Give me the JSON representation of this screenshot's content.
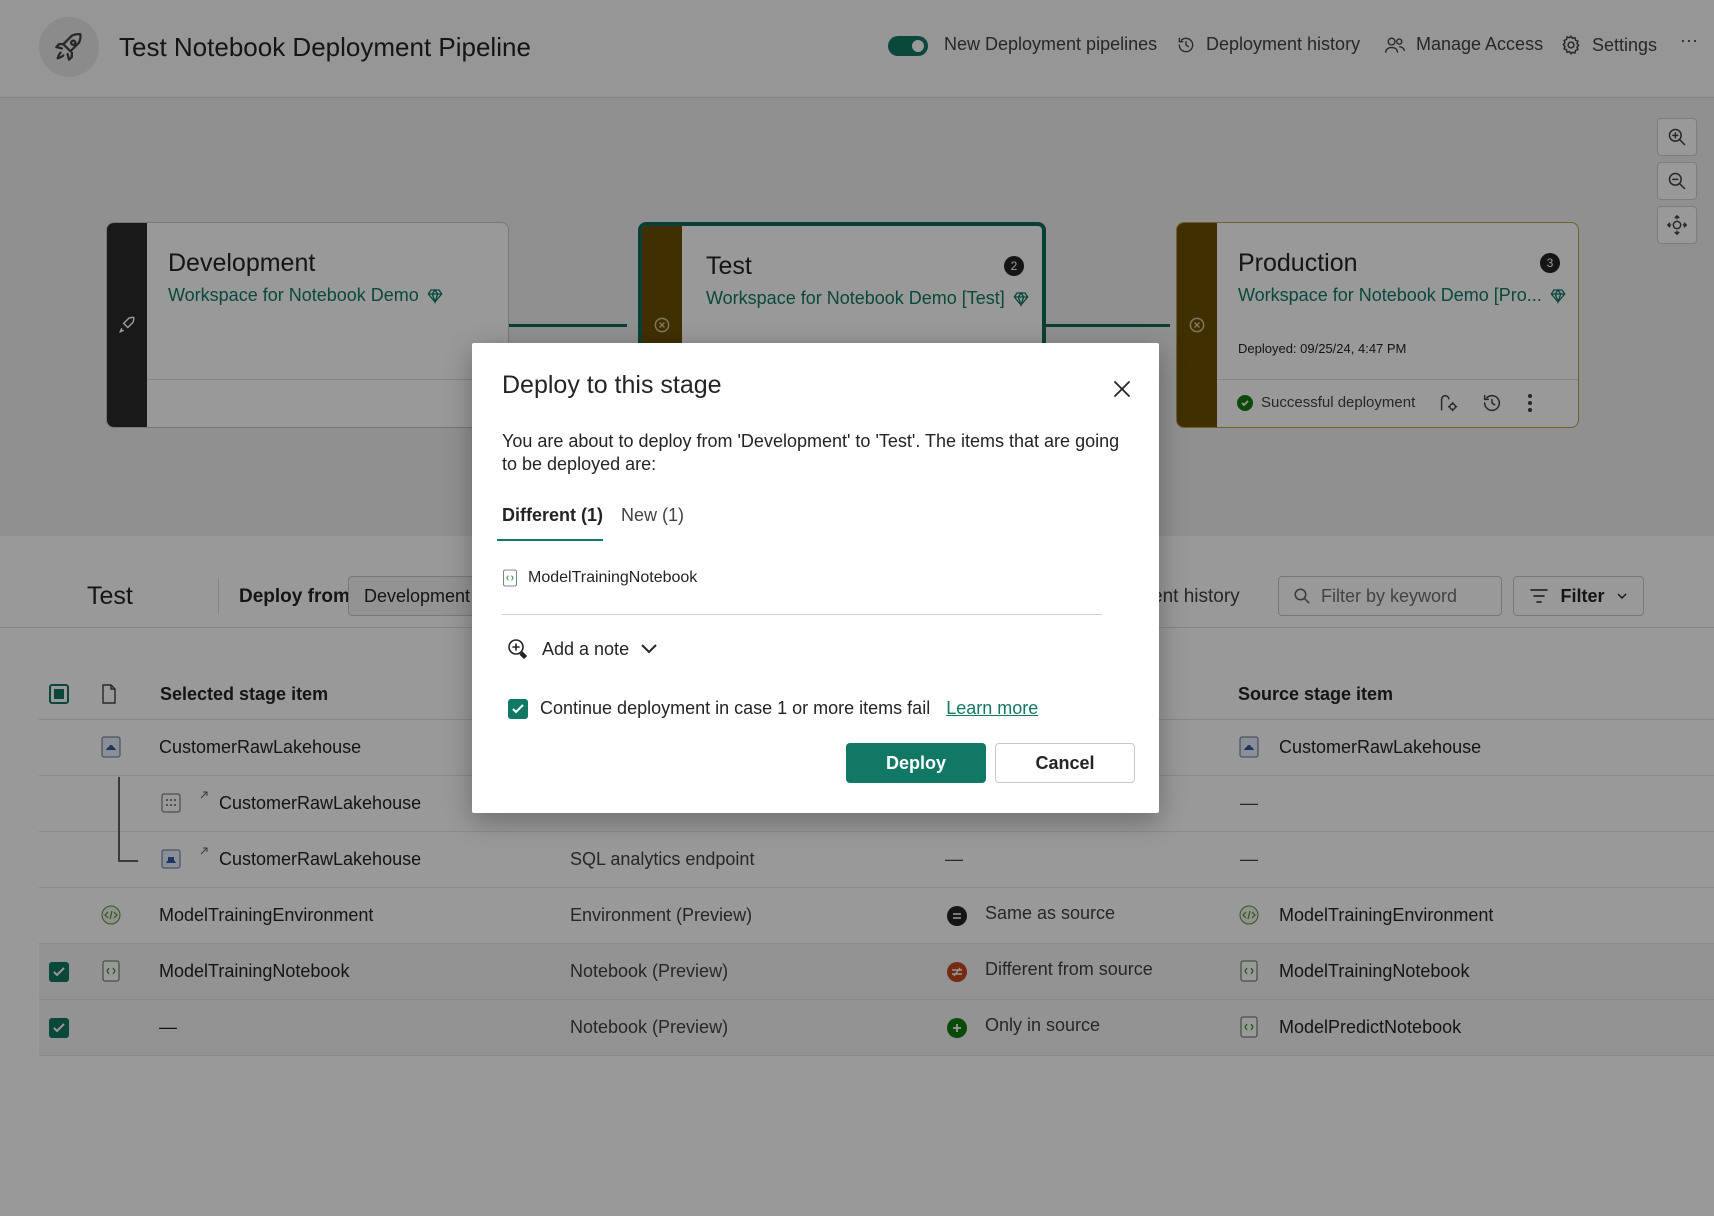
{
  "header": {
    "title": "Test Notebook Deployment Pipeline",
    "toggle_label": "New Deployment pipelines",
    "toggle_on": true,
    "history_label": "Deployment history",
    "access_label": "Manage Access",
    "settings_label": "Settings",
    "more_label": "···"
  },
  "stages": [
    {
      "name": "Development",
      "workspace": "Workspace for Notebook Demo",
      "bar_color": "#2b2b2b"
    },
    {
      "name": "Test",
      "workspace": "Workspace for Notebook Demo [Test]",
      "badge": "2",
      "bar_color": "#6b4f00"
    },
    {
      "name": "Production",
      "workspace": "Workspace for Notebook Demo [Pro...",
      "badge": "3",
      "deployed": "Deployed: 09/25/24, 4:47 PM",
      "status": "Successful deployment",
      "bar_color": "#6b4f00"
    }
  ],
  "panel": {
    "stage_title": "Test",
    "deploy_from_label": "Deploy from",
    "deploy_from_value": "Development",
    "history_link": "ent history",
    "filter_placeholder": "Filter by keyword",
    "filter_button": "Filter",
    "columns": {
      "selected": "Selected stage item",
      "source": "Source stage item"
    },
    "rows": [
      {
        "name": "CustomerRawLakehouse",
        "type": "",
        "status": "",
        "source": "CustomerRawLakehouse",
        "checked": false
      },
      {
        "name": "CustomerRawLakehouse",
        "type": "",
        "status": "",
        "source": "—",
        "checked": false
      },
      {
        "name": "CustomerRawLakehouse",
        "type": "SQL analytics endpoint",
        "status": "—",
        "source": "—",
        "checked": false
      },
      {
        "name": "ModelTrainingEnvironment",
        "type": "Environment (Preview)",
        "status": "Same as source",
        "source": "ModelTrainingEnvironment",
        "checked": false
      },
      {
        "name": "ModelTrainingNotebook",
        "type": "Notebook (Preview)",
        "status": "Different from source",
        "source": "ModelTrainingNotebook",
        "checked": true
      },
      {
        "name": "—",
        "type": "Notebook (Preview)",
        "status": "Only in source",
        "source": "ModelPredictNotebook",
        "checked": true
      }
    ]
  },
  "dialog": {
    "title": "Deploy to this stage",
    "description": "You are about to deploy from 'Development' to 'Test'. The items that are going to be deployed are:",
    "tabs": [
      {
        "label": "Different (1)"
      },
      {
        "label": "New (1)"
      }
    ],
    "item": "ModelTrainingNotebook",
    "add_note": "Add a note",
    "continue_label": "Continue deployment in case 1 or more items fail",
    "continue_checked": true,
    "learn_more": "Learn more",
    "deploy_button": "Deploy",
    "cancel_button": "Cancel"
  },
  "colors": {
    "accent": "#117865",
    "overlay": "rgba(0,0,0,0.40)"
  }
}
